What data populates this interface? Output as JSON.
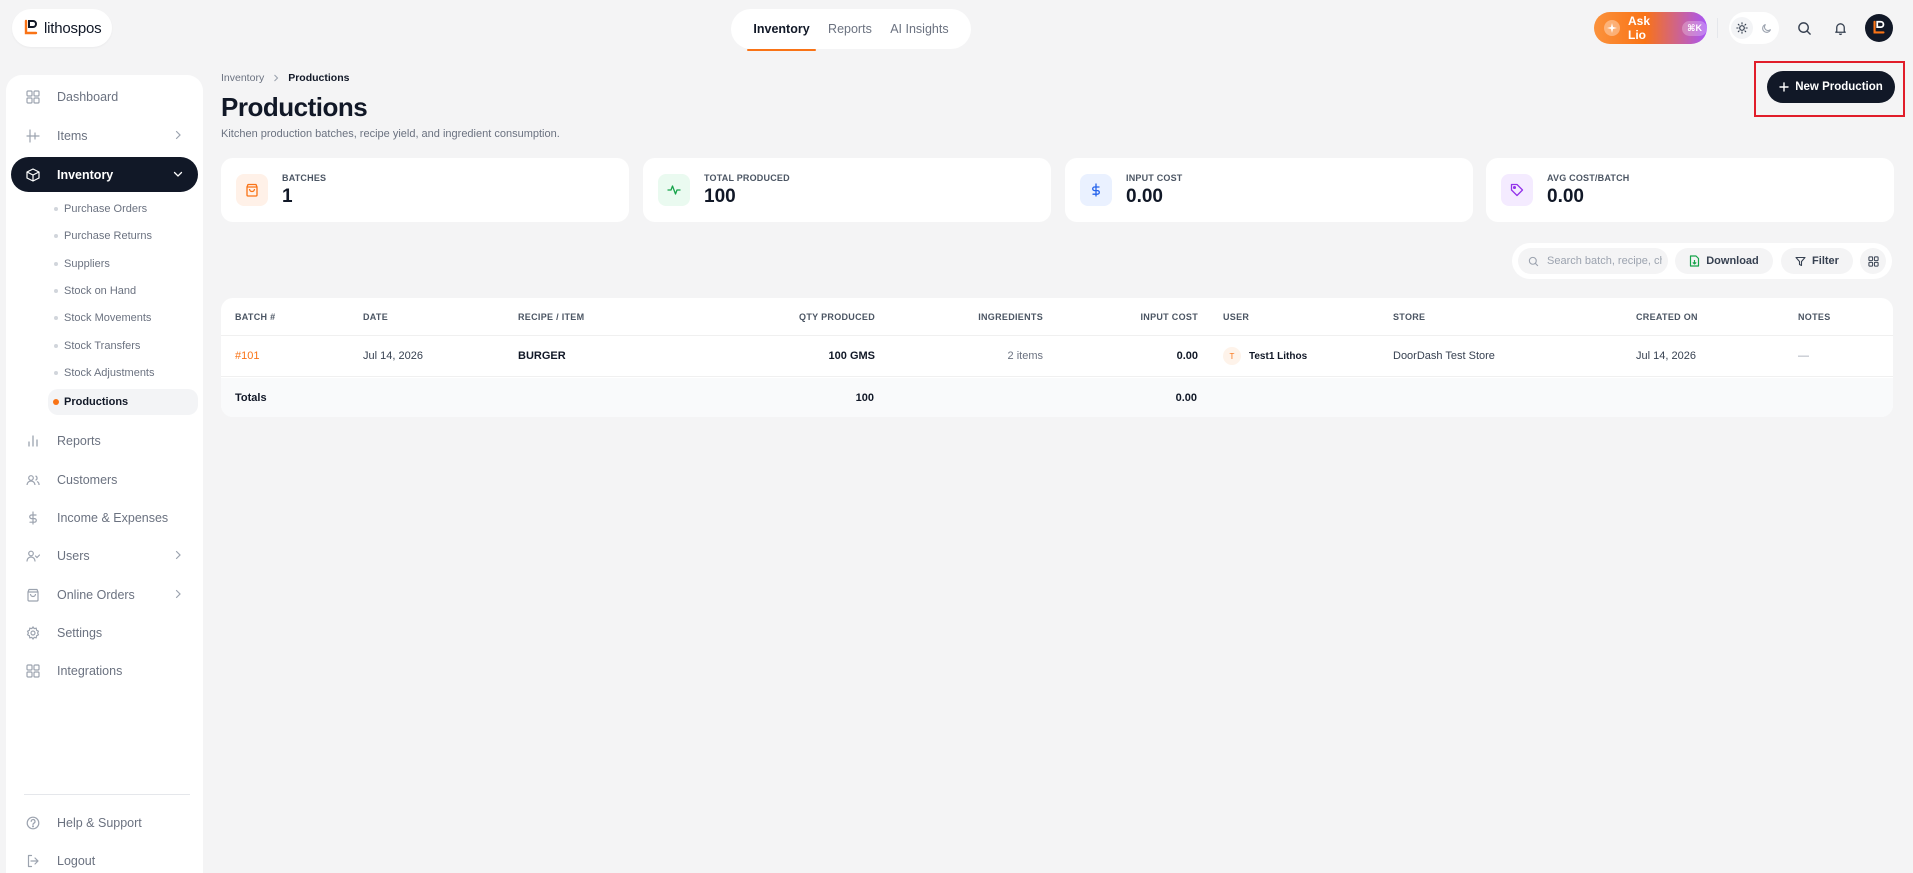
{
  "app": {
    "logo_text": "lithospos"
  },
  "topnav": {
    "items": [
      {
        "label": "Inventory",
        "active": true
      },
      {
        "label": "Reports",
        "active": false
      },
      {
        "label": "AI Insights",
        "active": false
      }
    ]
  },
  "header": {
    "ask_lio_label": "Ask Lio",
    "ask_lio_shortcut": "⌘K",
    "icons": [
      "sun-icon",
      "moon-icon",
      "search-icon",
      "bell-icon",
      "avatar"
    ]
  },
  "sidebar": {
    "items": [
      {
        "label": "Dashboard",
        "icon": "grid-icon"
      },
      {
        "label": "Items",
        "icon": "items-icon",
        "chevron": true
      },
      {
        "label": "Inventory",
        "icon": "box-icon",
        "chevron": true,
        "active": true
      },
      {
        "label": "Reports",
        "icon": "bar-chart-icon"
      },
      {
        "label": "Customers",
        "icon": "users-icon"
      },
      {
        "label": "Income & Expenses",
        "icon": "dollar-icon"
      },
      {
        "label": "Users",
        "icon": "user-check-icon",
        "chevron": true
      },
      {
        "label": "Online Orders",
        "icon": "bag-icon",
        "chevron": true
      },
      {
        "label": "Settings",
        "icon": "gear-icon"
      },
      {
        "label": "Integrations",
        "icon": "integrations-icon"
      }
    ],
    "inventory_subitems": [
      "Purchase Orders",
      "Purchase Returns",
      "Suppliers",
      "Stock on Hand",
      "Stock Movements",
      "Stock Transfers",
      "Stock Adjustments",
      "Productions"
    ],
    "active_subitem": "Productions",
    "footer": [
      {
        "label": "Help & Support",
        "icon": "help-icon"
      },
      {
        "label": "Logout",
        "icon": "logout-icon"
      }
    ]
  },
  "breadcrumb": {
    "parent": "Inventory",
    "current": "Productions"
  },
  "page": {
    "title": "Productions",
    "subtitle": "Kitchen production batches, recipe yield, and ingredient consumption.",
    "new_button": "New Production"
  },
  "stats": [
    {
      "label": "BATCHES",
      "value": "1",
      "icon": "bag-icon",
      "color": "#f97316",
      "bg": "#fff1e8"
    },
    {
      "label": "TOTAL PRODUCED",
      "value": "100",
      "icon": "activity-icon",
      "color": "#16a34a",
      "bg": "#eafaf0"
    },
    {
      "label": "INPUT COST",
      "value": "0.00",
      "icon": "dollar-icon",
      "color": "#2563eb",
      "bg": "#eaf1ff"
    },
    {
      "label": "AVG COST/BATCH",
      "value": "0.00",
      "icon": "tag-icon",
      "color": "#9333ea",
      "bg": "#f4ebff"
    }
  ],
  "toolbar": {
    "search_placeholder": "Search batch, recipe, chef",
    "download_label": "Download",
    "filter_label": "Filter"
  },
  "table": {
    "columns": [
      "BATCH #",
      "DATE",
      "RECIPE / ITEM",
      "QTY PRODUCED",
      "INGREDIENTS",
      "INPUT COST",
      "USER",
      "STORE",
      "CREATED ON",
      "NOTES"
    ],
    "rows": [
      {
        "batch": "#101",
        "date": "Jul 14, 2026",
        "recipe": "BURGER",
        "qty": "100 GMS",
        "ingredients": "2 items",
        "input_cost": "0.00",
        "user_initial": "T",
        "user": "Test1 Lithos",
        "store": "DoorDash Test Store",
        "created_on": "Jul 14, 2026",
        "notes": "—"
      }
    ],
    "totals": {
      "label": "Totals",
      "qty": "100",
      "input_cost": "0.00"
    }
  },
  "colors": {
    "accent": "#f97316",
    "dark": "#111827",
    "highlight_outline": "#e11d2a"
  }
}
